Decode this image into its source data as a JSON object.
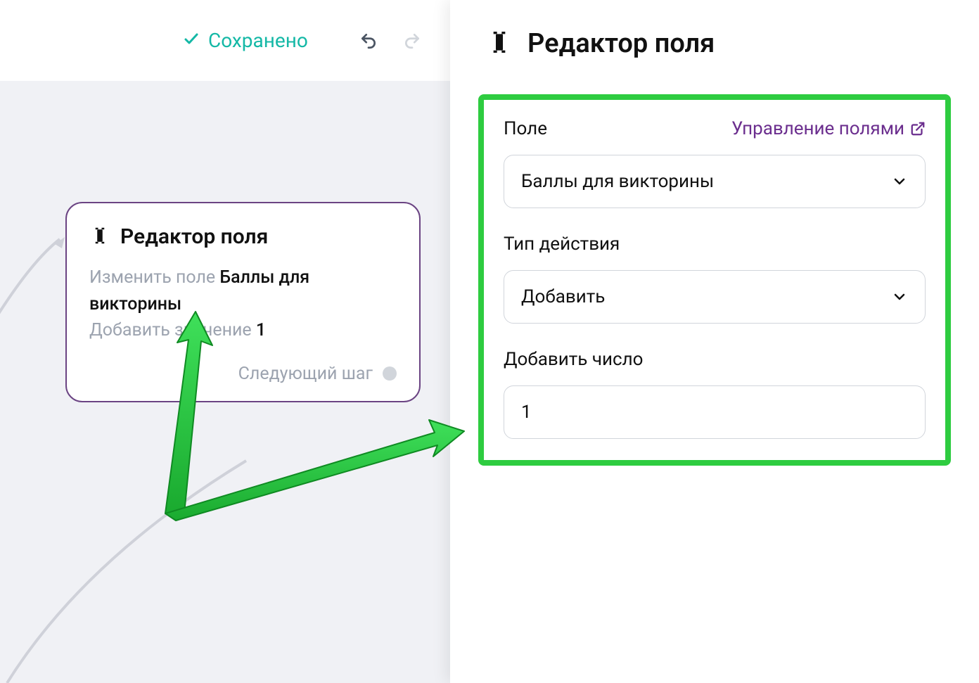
{
  "toolbar": {
    "saved_label": "Сохранено"
  },
  "node": {
    "title": "Редактор поля",
    "line1_prefix": "Изменить поле ",
    "line1_value": "Баллы для викторины",
    "line2_prefix": "Добавить значение ",
    "line2_value": "1",
    "next_step_label": "Следующий шаг"
  },
  "panel": {
    "title": "Редактор поля",
    "field_label": "Поле",
    "manage_fields_label": "Управление полями",
    "field_select_value": "Баллы для викторины",
    "action_type_label": "Тип действия",
    "action_select_value": "Добавить",
    "add_number_label": "Добавить число",
    "add_number_value": "1"
  }
}
